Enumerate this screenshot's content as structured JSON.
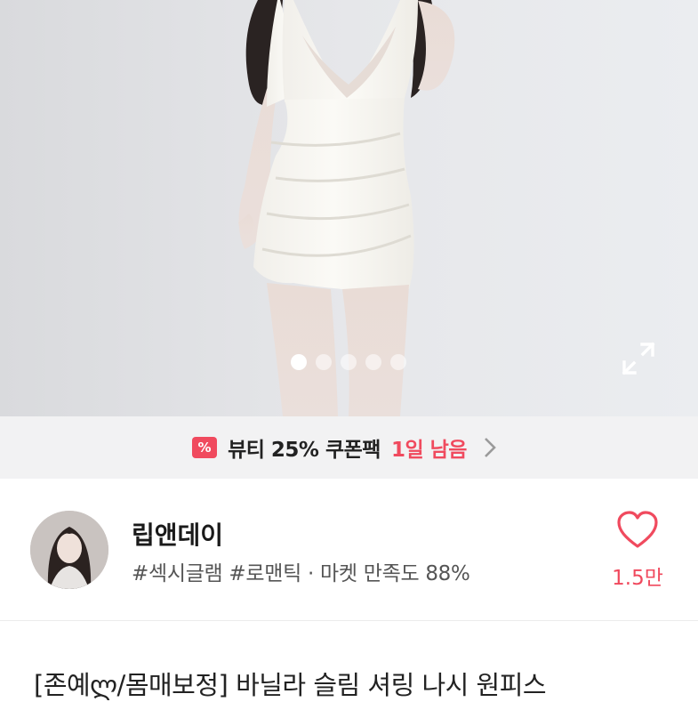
{
  "hero": {
    "image": "product-photo-white-mini-dress",
    "slide_total": 5,
    "active_slide": 1
  },
  "coupon": {
    "icon": "coupon-percent-icon",
    "icon_glyph": "%",
    "text": "뷰티 25% 쿠폰팩",
    "time_left": "1일 남음",
    "accent_color": "#f04a5e"
  },
  "seller": {
    "avatar": "seller-avatar",
    "name": "립앤데이",
    "tags": "#섹시글램 #로맨틱 · 마켓 만족도 88%",
    "like_count": "1.5만"
  },
  "product": {
    "title": "[존예ლ/몸매보정] 바닐라 슬림 셔링 나시 원피스"
  }
}
